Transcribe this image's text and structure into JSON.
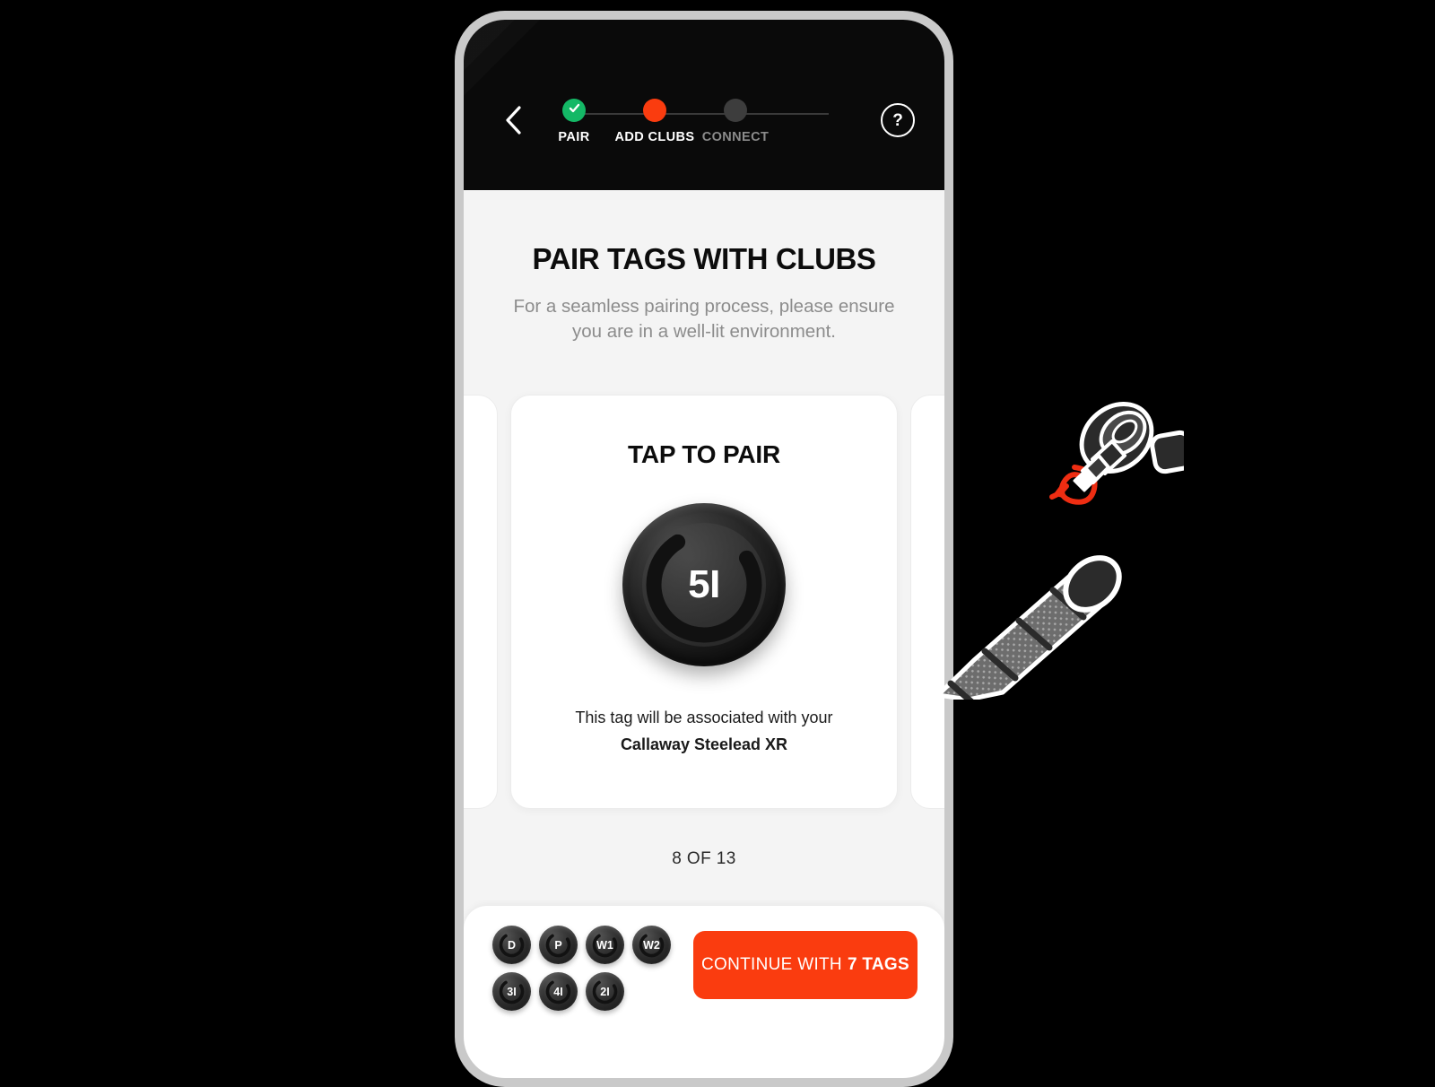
{
  "theme": {
    "accent": "#fa3c0f",
    "done": "#14b866",
    "inactive": "#3d3d3d",
    "header_bg": "#0a0a0a",
    "screen_bg": "#f4f4f4",
    "frame": "#c9c9c9"
  },
  "header": {
    "back_icon": "chevron-left-icon",
    "help_icon": "question-mark-icon",
    "help_label": "?",
    "steps": [
      {
        "label": "PAIR",
        "state": "done",
        "icon": "check-icon"
      },
      {
        "label": "ADD CLUBS",
        "state": "active",
        "icon": "dot-icon"
      },
      {
        "label": "CONNECT",
        "state": "todo",
        "icon": "dot-icon"
      }
    ]
  },
  "page": {
    "title": "PAIR TAGS WITH CLUBS",
    "subtitle": "For a seamless pairing process, please ensure you are in a well-lit environment."
  },
  "card": {
    "title": "TAP TO PAIR",
    "tag_label": "5I",
    "note_line1": "This tag will be associated with your",
    "note_club": "Callaway Steelead XR"
  },
  "pager": {
    "text": "8 OF 13",
    "current": 8,
    "total": 13
  },
  "bottom": {
    "chips": [
      {
        "label": "D"
      },
      {
        "label": "P"
      },
      {
        "label": "W1"
      },
      {
        "label": "W2"
      },
      {
        "label": "3I"
      },
      {
        "label": "4I"
      },
      {
        "label": "2I"
      }
    ],
    "continue_prefix": "CONTINUE WITH",
    "continue_count": "7 TAGS"
  },
  "illustration": {
    "name": "golf-club-grip-with-tag-illustration",
    "arrow_color": "#ee2d12"
  }
}
